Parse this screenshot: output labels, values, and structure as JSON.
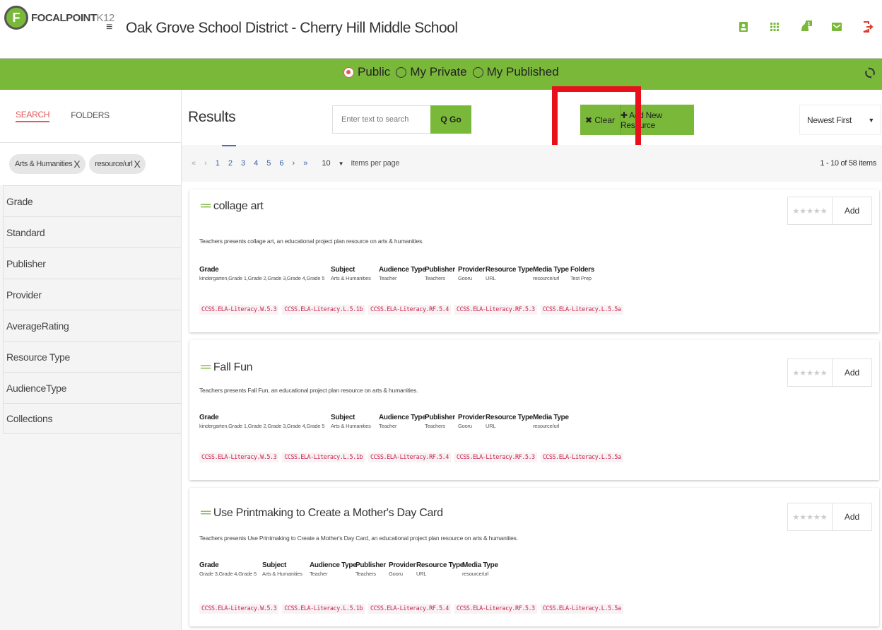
{
  "header": {
    "logo_mark": "F",
    "logo_brand": "FOCALPOINT",
    "logo_suffix": "K12",
    "menu_glyph": "≡",
    "district": "Oak Grove School District - Cherry Hill Middle School",
    "icons": [
      "contact-card-icon",
      "apps-grid-icon",
      "notifications-bell-icon",
      "mail-icon",
      "logout-icon"
    ]
  },
  "scope": {
    "options": [
      "Public",
      "My Private",
      "My Published"
    ],
    "selected": "Public"
  },
  "sidebar": {
    "tabs": [
      "SEARCH",
      "FOLDERS"
    ],
    "active_tab": "SEARCH",
    "chips": [
      "Arts & Humanities",
      "resource/url"
    ],
    "chip_close": "X",
    "facets": [
      "Grade",
      "Standard",
      "Publisher",
      "Provider",
      "AverageRating",
      "Resource Type",
      "AudienceType",
      "Collections"
    ]
  },
  "results": {
    "title": "Results",
    "search_placeholder": "Enter text to search",
    "go_label": "Q Go",
    "clear_label": "✖ Clear",
    "add_new_label": "✚ Add New Resource",
    "sort_label": "Newest First",
    "caret": "▼"
  },
  "pager": {
    "first": "«",
    "prev": "‹",
    "pages": [
      "1",
      "2",
      "3",
      "4",
      "5",
      "6"
    ],
    "next": "›",
    "last": "»",
    "per_page": "10",
    "per_page_caret": "▼",
    "per_page_label": "items per page",
    "count": "1 - 10 of 58 items"
  },
  "card_common": {
    "stars": "★★★★★",
    "add_label": "Add",
    "title_icon": "═"
  },
  "cards": [
    {
      "title": "collage art",
      "description": "Teachers presents collage art, an educational project plan resource on arts & humanities.",
      "meta": [
        {
          "h": "Grade",
          "v": "kindergarten,Grade 1,Grade 2,Grade 3,Grade 4,Grade 5"
        },
        {
          "h": "Subject",
          "v": "Arts & Humanities"
        },
        {
          "h": "Audience Type",
          "v": "Teacher"
        },
        {
          "h": "Publisher",
          "v": "Teachers"
        },
        {
          "h": "Provider",
          "v": "Gooru"
        },
        {
          "h": "Resource Type",
          "v": "URL"
        },
        {
          "h": "Media Type",
          "v": "resource/url"
        },
        {
          "h": "Folders",
          "v": "Test Prep"
        }
      ],
      "standards": [
        "CCSS.ELA-Literacy.W.5.3",
        "CCSS.ELA-Literacy.L.5.1b",
        "CCSS.ELA-Literacy.RF.5.4",
        "CCSS.ELA-Literacy.RF.5.3",
        "CCSS.ELA-Literacy.L.5.5a"
      ]
    },
    {
      "title": "Fall Fun",
      "description": "Teachers presents Fall Fun, an educational project plan resource on arts & humanities.",
      "meta": [
        {
          "h": "Grade",
          "v": "kindergarten,Grade 1,Grade 2,Grade 3,Grade 4,Grade 5"
        },
        {
          "h": "Subject",
          "v": "Arts & Humanities"
        },
        {
          "h": "Audience Type",
          "v": "Teacher"
        },
        {
          "h": "Publisher",
          "v": "Teachers"
        },
        {
          "h": "Provider",
          "v": "Gooru"
        },
        {
          "h": "Resource Type",
          "v": "URL"
        },
        {
          "h": "Media Type",
          "v": "resource/url"
        }
      ],
      "standards": [
        "CCSS.ELA-Literacy.W.5.3",
        "CCSS.ELA-Literacy.L.5.1b",
        "CCSS.ELA-Literacy.RF.5.4",
        "CCSS.ELA-Literacy.RF.5.3",
        "CCSS.ELA-Literacy.L.5.5a"
      ]
    },
    {
      "title": "Use Printmaking to Create a Mother's Day Card",
      "description": "Teachers presents Use Printmaking to Create a Mother's Day Card, an educational project plan resource on arts & humanities.",
      "meta": [
        {
          "h": "Grade",
          "v": "Grade 3,Grade 4,Grade 5"
        },
        {
          "h": "Subject",
          "v": "Arts & Humanities"
        },
        {
          "h": "Audience Type",
          "v": "Teacher"
        },
        {
          "h": "Publisher",
          "v": "Teachers"
        },
        {
          "h": "Provider",
          "v": "Gooru"
        },
        {
          "h": "Resource Type",
          "v": "URL"
        },
        {
          "h": "Media Type",
          "v": "resource/url"
        }
      ],
      "standards": [
        "CCSS.ELA-Literacy.W.5.3",
        "CCSS.ELA-Literacy.L.5.1b",
        "CCSS.ELA-Literacy.RF.5.4",
        "CCSS.ELA-Literacy.RF.5.3",
        "CCSS.ELA-Literacy.L.5.5a"
      ]
    }
  ],
  "colors": {
    "brand_green": "#7ab83a",
    "accent_red": "#e05b5b",
    "highlight_red": "#e8101a",
    "standard_code": "#c7254e"
  }
}
